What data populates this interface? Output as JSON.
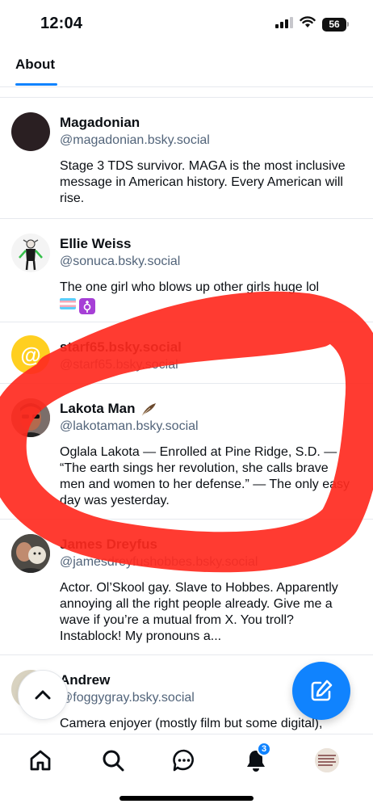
{
  "status_bar": {
    "time": "12:04",
    "battery": "56"
  },
  "tabs": [
    {
      "label": "About"
    }
  ],
  "profiles": [
    {
      "name": "Magadonian",
      "handle": "@magadonian.bsky.social",
      "bio": "Stage 3 TDS survivor. MAGA is the most inclusive message in American history. Every American will rise.",
      "avatar": "dark-circle"
    },
    {
      "name": "Ellie Weiss",
      "handle": "@sonuca.bsky.social",
      "bio": "The one girl who blows up other girls huge lol",
      "bio_emoji": [
        "transgender-flag",
        "transgender-symbol"
      ],
      "avatar": "character-drawing"
    },
    {
      "name": "starf65.bsky.social",
      "handle": "@starf65.bsky.social",
      "bio": "",
      "avatar": "at-sign-yellow"
    },
    {
      "name": "Lakota Man",
      "name_emoji": "feather",
      "handle": "@lakotaman.bsky.social",
      "bio": "Oglala Lakota — Enrolled at Pine Ridge, S.D. — “The earth sings her revolution, she calls brave men and women to her defense.” — The only easy day was yesterday.",
      "avatar": "man-sunglasses"
    },
    {
      "name": "James Dreyfus",
      "handle": "@jamesdreyfushobbes.bsky.social",
      "bio": "Actor. Ol’Skool gay. Slave to Hobbes. Apparently annoying all the right people already. Give me a wave if you’re a mutual from X. You troll? Instablock! My pronouns a...",
      "avatar": "man-with-dog"
    },
    {
      "name": "Andrew",
      "handle": "@foggygray.bsky.social",
      "bio": "Camera enjoyer (mostly film but some digital),",
      "avatar": "photo"
    }
  ],
  "nav": {
    "notifications_badge": "3"
  },
  "colors": {
    "accent": "#1083fe",
    "annotation": "#ff2a1f",
    "handle": "#52647a"
  }
}
